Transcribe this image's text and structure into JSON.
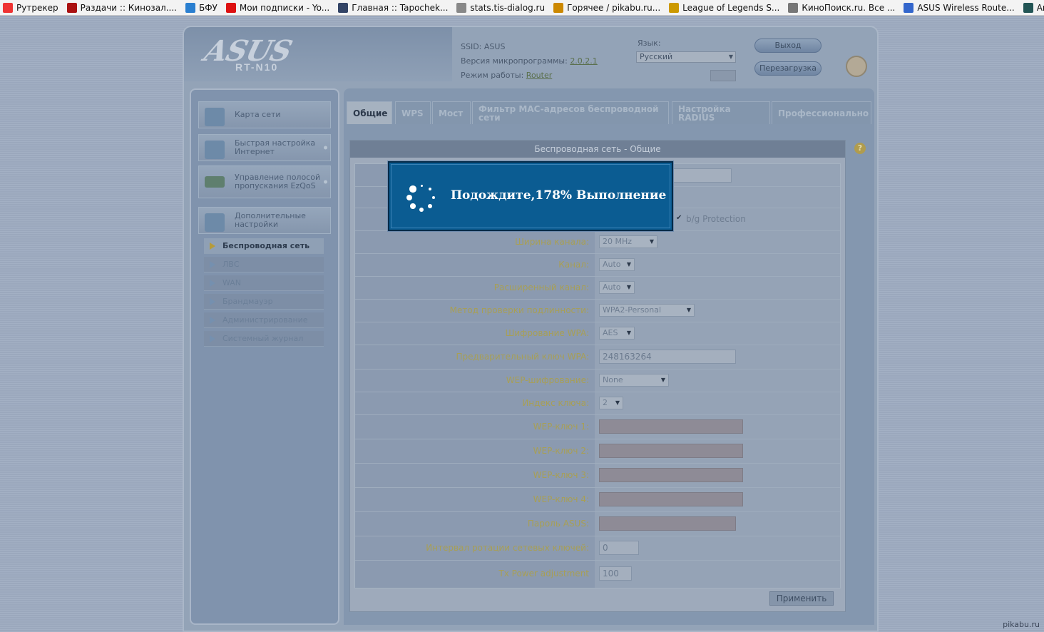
{
  "bookmarks": [
    {
      "label": "Рутрекер",
      "color": "#e33"
    },
    {
      "label": "Раздачи :: Кинозал....",
      "color": "#a11"
    },
    {
      "label": "БФУ",
      "color": "#2a7fd0"
    },
    {
      "label": "Мои подписки - Yo...",
      "color": "#d11"
    },
    {
      "label": "Главная :: Tapochek...",
      "color": "#346"
    },
    {
      "label": "stats.tis-dialog.ru",
      "color": "#888"
    },
    {
      "label": "Горячее / pikabu.ru...",
      "color": "#c80"
    },
    {
      "label": "League of Legends S...",
      "color": "#c90"
    },
    {
      "label": "КиноПоиск.ru. Все ...",
      "color": "#777"
    },
    {
      "label": "ASUS Wireless Route...",
      "color": "#36c"
    },
    {
      "label": "Anidub Смотреть А...",
      "color": "#255"
    }
  ],
  "header": {
    "logo": "ASUS",
    "model": "RT-N10",
    "ssid_label": "SSID:",
    "ssid_value": "ASUS",
    "firmware_label": "Версия микропрограммы:",
    "firmware_value": "2.0.2.1",
    "mode_label": "Режим работы:",
    "mode_value": "Router",
    "language_label": "Язык:",
    "language_value": "Русский",
    "logout": "Выход",
    "reboot": "Перезагрузка"
  },
  "sidebar": {
    "menus": [
      {
        "label": "Карта сети"
      },
      {
        "label": "Быстрая настройка Интернет"
      },
      {
        "label": "Управление полосой пропускания EzQoS"
      },
      {
        "label": "Дополнительные настройки"
      }
    ],
    "submenu": [
      {
        "label": "Беспроводная сеть"
      },
      {
        "label": "ЛВС"
      },
      {
        "label": "WAN"
      },
      {
        "label": "Брандмауэр"
      },
      {
        "label": "Администрирование"
      },
      {
        "label": "Системный журнал"
      }
    ]
  },
  "tabs": [
    {
      "label": "Общие"
    },
    {
      "label": "WPS"
    },
    {
      "label": "Мост"
    },
    {
      "label": "Фильтр MAC-адресов беспроводной сети"
    },
    {
      "label": "Настройка RADIUS"
    },
    {
      "label": "Профессионально"
    }
  ],
  "panel": {
    "title": "Беспроводная сеть - Общие",
    "protection_text": "b/g Protection",
    "apply": "Применить"
  },
  "form": {
    "channel_width": {
      "label": "Ширина канала:",
      "value": "20 MHz"
    },
    "channel": {
      "label": "Канал:",
      "value": "Auto"
    },
    "ext_channel": {
      "label": "Расширенный канал:",
      "value": "Auto"
    },
    "auth_method": {
      "label": "Метод проверки подлинности:",
      "value": "WPA2-Personal"
    },
    "wpa_encryption": {
      "label": "Шифрование WPA:",
      "value": "AES"
    },
    "wpa_key": {
      "label": "Предварительный ключ WPA:",
      "value": "248163264"
    },
    "wep_encryption": {
      "label": "WEP-шифрование:",
      "value": "None"
    },
    "key_index": {
      "label": "Индекс ключа:",
      "value": "2"
    },
    "wep_key1": {
      "label": "WEP-ключ 1:"
    },
    "wep_key2": {
      "label": "WEP-ключ 2:"
    },
    "wep_key3": {
      "label": "WEP-ключ 3:"
    },
    "wep_key4": {
      "label": "WEP-ключ 4:"
    },
    "asus_password": {
      "label": "Пароль ASUS:"
    },
    "key_rotation": {
      "label": "Интервал ротации сетевых ключей:",
      "value": "0"
    },
    "tx_power": {
      "label": "Tx Power adjustment",
      "value": "100"
    }
  },
  "modal": {
    "text": "Подождите,178% Выполнение"
  },
  "watermark": "pikabu.ru"
}
